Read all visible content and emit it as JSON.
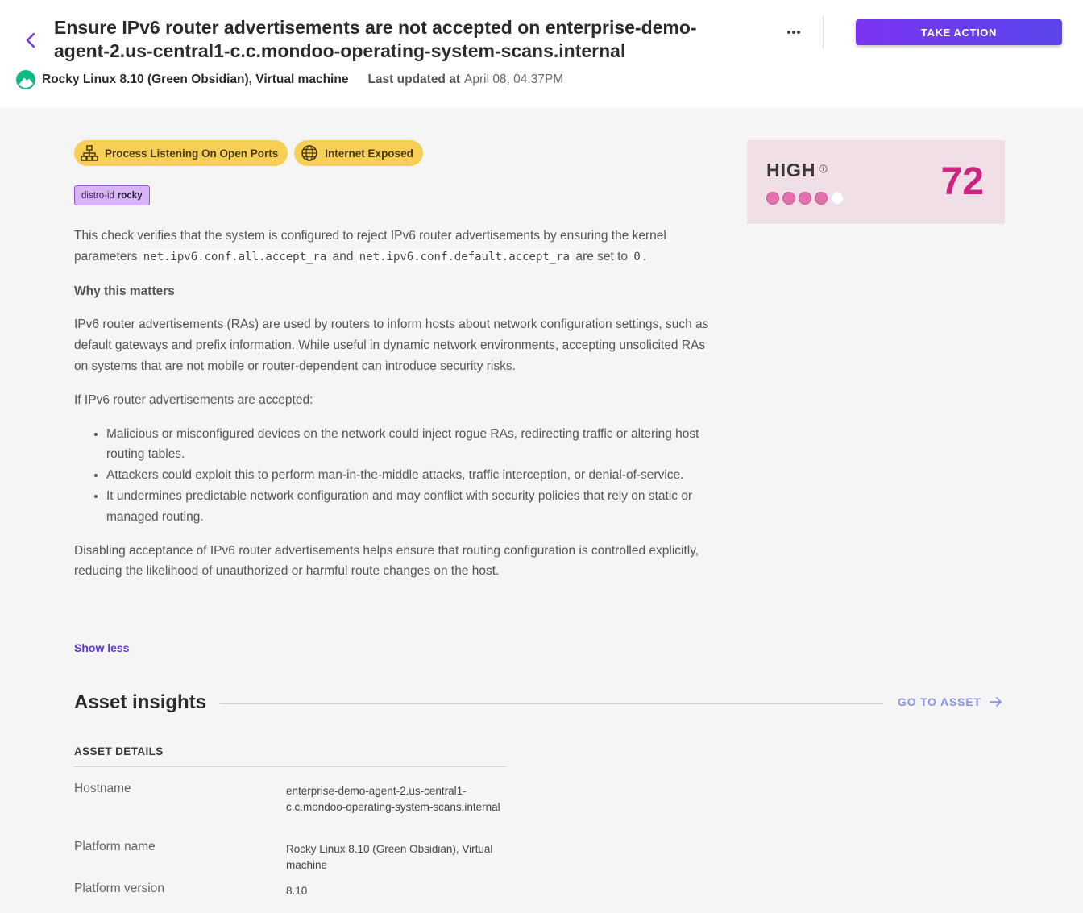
{
  "header": {
    "title": "Ensure IPv6 router advertisements are not accepted on enterprise-demo-agent-2.us-central1-c.c.mondoo-operating-system-scans.internal",
    "platform": "Rocky Linux 8.10 (Green Obsidian), Virtual machine",
    "last_updated_label": "Last updated at",
    "last_updated_value": "April 08, 04:37PM",
    "take_action_label": "TAKE ACTION"
  },
  "chips": [
    {
      "label": "Process Listening On Open Ports",
      "icon": "network-icon"
    },
    {
      "label": "Internet Exposed",
      "icon": "globe-icon"
    }
  ],
  "tag": {
    "key": "distro-id",
    "value": "rocky"
  },
  "description": {
    "intro_1": "This check verifies that the system is configured to reject IPv6 router advertisements by ensuring the kernel parameters",
    "code_1": "net.ipv6.conf.all.accept_ra",
    "and": "and",
    "code_2": "net.ipv6.conf.default.accept_ra",
    "are_set_to": "are set to",
    "code_3": "0",
    "period": ".",
    "why_heading": "Why this matters",
    "para_1": "IPv6 router advertisements (RAs) are used by routers to inform hosts about network configuration settings, such as default gateways and prefix information. While useful in dynamic network environments, accepting unsolicited RAs on systems that are not mobile or router-dependent can introduce security risks.",
    "para_2": "If IPv6 router advertisements are accepted:",
    "bullets": [
      "Malicious or misconfigured devices on the network could inject rogue RAs, redirecting traffic or altering host routing tables.",
      "Attackers could exploit this to perform man-in-the-middle attacks, traffic interception, or denial-of-service.",
      "It undermines predictable network configuration and may conflict with security policies that rely on static or managed routing."
    ],
    "para_3": "Disabling acceptance of IPv6 router advertisements helps ensure that routing configuration is controlled explicitly, reducing the likelihood of unauthorized or harmful route changes on the host.",
    "show_less": "Show less"
  },
  "risk": {
    "severity": "HIGH",
    "score": "72",
    "filled_dots": 4,
    "total_dots": 5,
    "accent_color": "#cb2580"
  },
  "asset_insights": {
    "title": "Asset insights",
    "go_to_asset": "GO TO ASSET",
    "details_heading": "ASSET DETAILS",
    "rows": [
      {
        "key": "Hostname",
        "value": "enterprise-demo-agent-2.us-central1-c.c.mondoo-operating-system-scans.internal"
      },
      {
        "key": "Platform name",
        "value": "Rocky Linux 8.10 (Green Obsidian), Virtual machine"
      },
      {
        "key": "Platform version",
        "value": "8.10"
      }
    ]
  }
}
